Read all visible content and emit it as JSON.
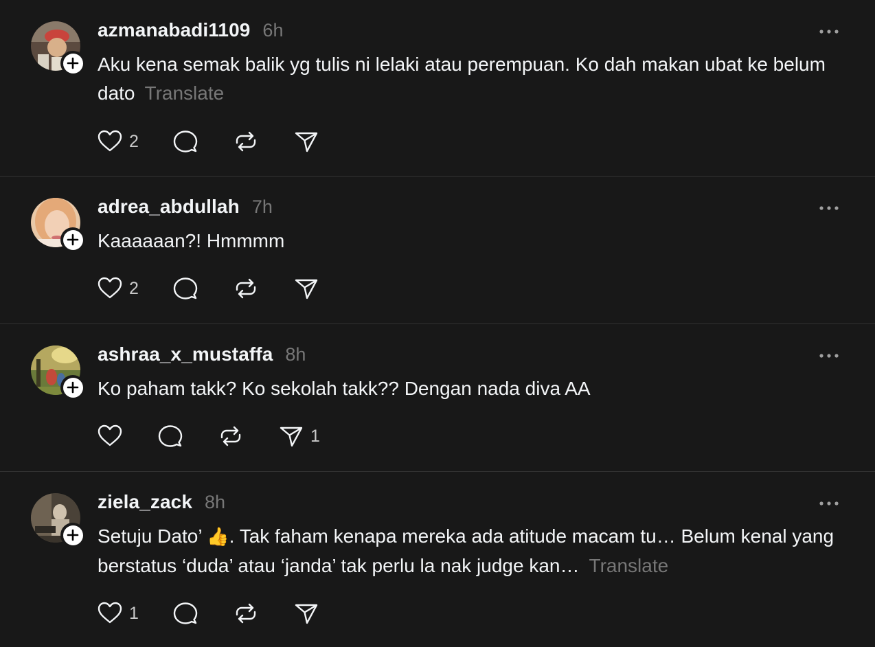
{
  "posts": [
    {
      "username": "azmanabadi1109",
      "time": "6h",
      "text": "Aku kena semak balik yg tulis ni lelaki atau perempuan. Ko dah makan ubat ke belum dato",
      "translate": "Translate",
      "likes": "2",
      "reposts_count": "",
      "shares": ""
    },
    {
      "username": "adrea_abdullah",
      "time": "7h",
      "text": "Kaaaaaan?! Hmmmm",
      "translate": "",
      "likes": "2",
      "shares": ""
    },
    {
      "username": "ashraa_x_mustaffa",
      "time": "8h",
      "text": "Ko paham takk? Ko sekolah takk?? Dengan nada diva AA",
      "translate": "",
      "likes": "",
      "shares": "1"
    },
    {
      "username": "ziela_zack",
      "time": "8h",
      "text_before_emoji": "Setuju Dato’ ",
      "emoji": "👍",
      "text_after_emoji": ". Tak faham kenapa mereka ada atitude macam tu… Belum kenal yang berstatus ‘duda’ atau ‘janda’ tak perlu la nak judge kan…",
      "translate": "Translate",
      "likes": "1",
      "shares": ""
    }
  ],
  "icons": {
    "like": "heart-icon",
    "comment": "comment-bubble-icon",
    "repost": "repost-icon",
    "share": "send-icon",
    "more": "more-horizontal-icon",
    "follow": "plus-icon"
  },
  "colors": {
    "background": "#181818",
    "text": "#f3f5f7",
    "muted": "#777777",
    "divider": "#323232"
  }
}
